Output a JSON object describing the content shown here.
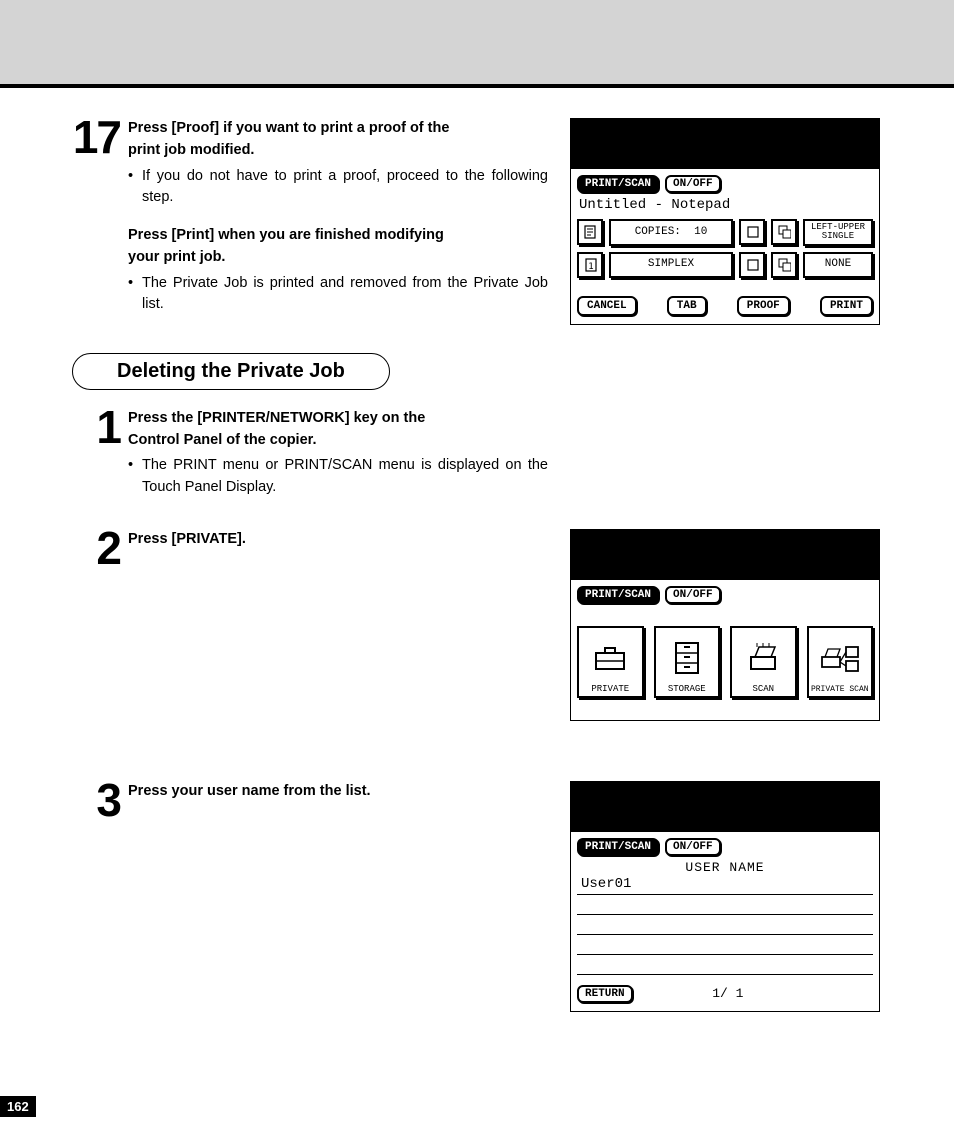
{
  "step17": {
    "num": "17",
    "heading1a": "Press [Proof] if you want to print a proof of the",
    "heading1b": "print job modified.",
    "bullet1": "If you do not have to print a proof, proceed to the following step.",
    "heading2a": "Press [Print] when you are finished modifying",
    "heading2b": "your print job.",
    "bullet2": "The Private Job is printed and removed from the Private Job list."
  },
  "section_title": "Deleting the Private Job",
  "step1": {
    "num": "1",
    "heading_a": "Press the [PRINTER/NETWORK] key on the",
    "heading_b": "Control Panel of the copier.",
    "bullet": "The PRINT menu or PRINT/SCAN menu is displayed on the Touch Panel Display."
  },
  "step2": {
    "num": "2",
    "heading": "Press [PRIVATE]."
  },
  "step3": {
    "num": "3",
    "heading": "Press your user name from the list."
  },
  "screen1": {
    "printscan": "PRINT/SCAN",
    "onoff": "ON/OFF",
    "docname": "Untitled - Notepad",
    "copies_label": "COPIES:",
    "copies_value": "10",
    "staple": "LEFT-UPPER SINGLE",
    "simplex": "SIMPLEX",
    "none": "NONE",
    "cancel": "CANCEL",
    "tab": "TAB",
    "proof": "PROOF",
    "print": "PRINT"
  },
  "screen2": {
    "printscan": "PRINT/SCAN",
    "onoff": "ON/OFF",
    "private": "PRIVATE",
    "storage": "STORAGE",
    "scan": "SCAN",
    "pscan": "PRIVATE SCAN"
  },
  "screen3": {
    "printscan": "PRINT/SCAN",
    "onoff": "ON/OFF",
    "header": "USER NAME",
    "user": "User01",
    "return": "RETURN",
    "page": "1/ 1"
  },
  "page_number": "162"
}
